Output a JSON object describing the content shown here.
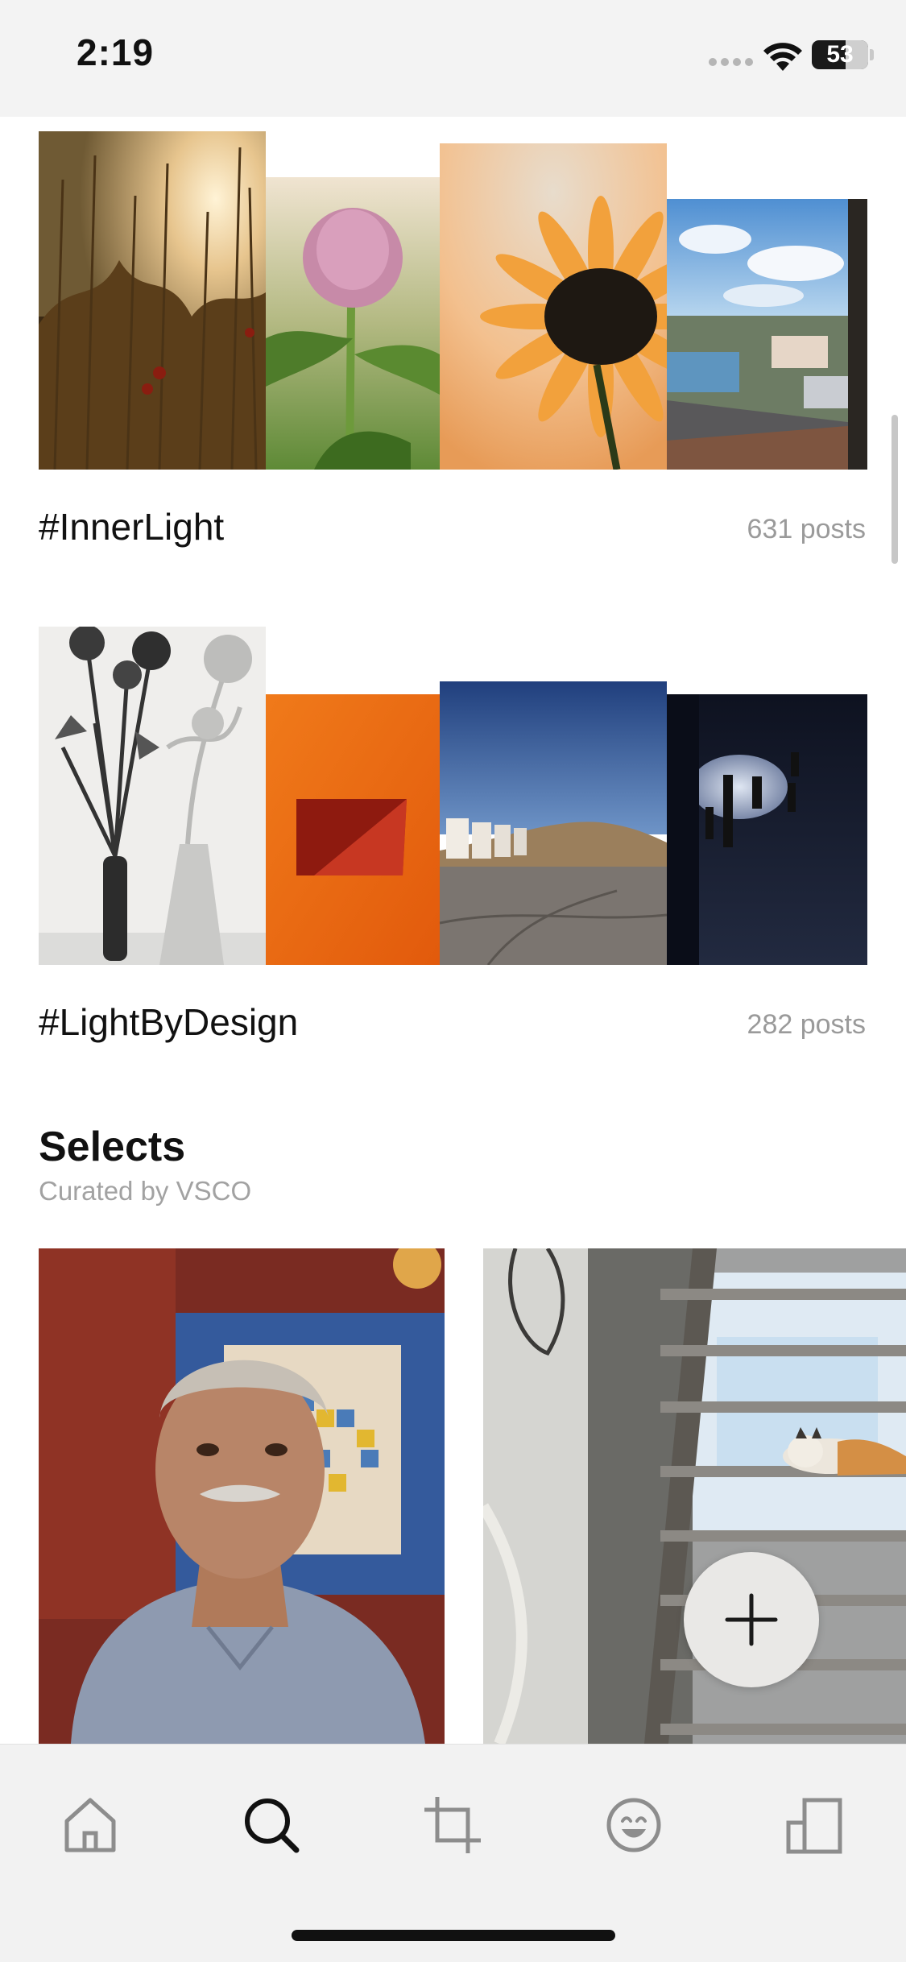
{
  "status_bar": {
    "time": "2:19",
    "battery": "53",
    "icons": [
      "signal-dots-icon",
      "wifi-icon",
      "battery-icon"
    ]
  },
  "hashtags": [
    {
      "title": "#InnerLight",
      "count": "631 posts",
      "photos": [
        "field-grass-sunset-photo",
        "pink-clover-flower-photo",
        "orange-daisy-backlit-photo",
        "town-rooftops-sky-photo"
      ]
    },
    {
      "title": "#LightByDesign",
      "count": "282 posts",
      "photos": [
        "carnation-vase-shadow-photo",
        "orange-wall-red-square-photo",
        "beach-huts-blue-sky-photo",
        "silhouettes-spotlight-photo"
      ]
    }
  ],
  "selects": {
    "title": "Selects",
    "subtitle": "Curated by VSCO",
    "photos": [
      "portrait-older-man-photo",
      "cat-under-stairs-photo"
    ]
  },
  "fab": {
    "icon": "plus-icon"
  },
  "tab_bar": {
    "tabs": [
      "home-tab",
      "search-tab",
      "studio-tab",
      "spaces-tab",
      "profile-tab"
    ],
    "active": "search-tab"
  },
  "colors": {
    "background": "#ffffff",
    "status_bar_bg": "#f3f3f3",
    "tab_bar_bg": "#f2f2f2",
    "muted_text": "#9a9a9a",
    "fab_bg": "#e9e8e6"
  }
}
